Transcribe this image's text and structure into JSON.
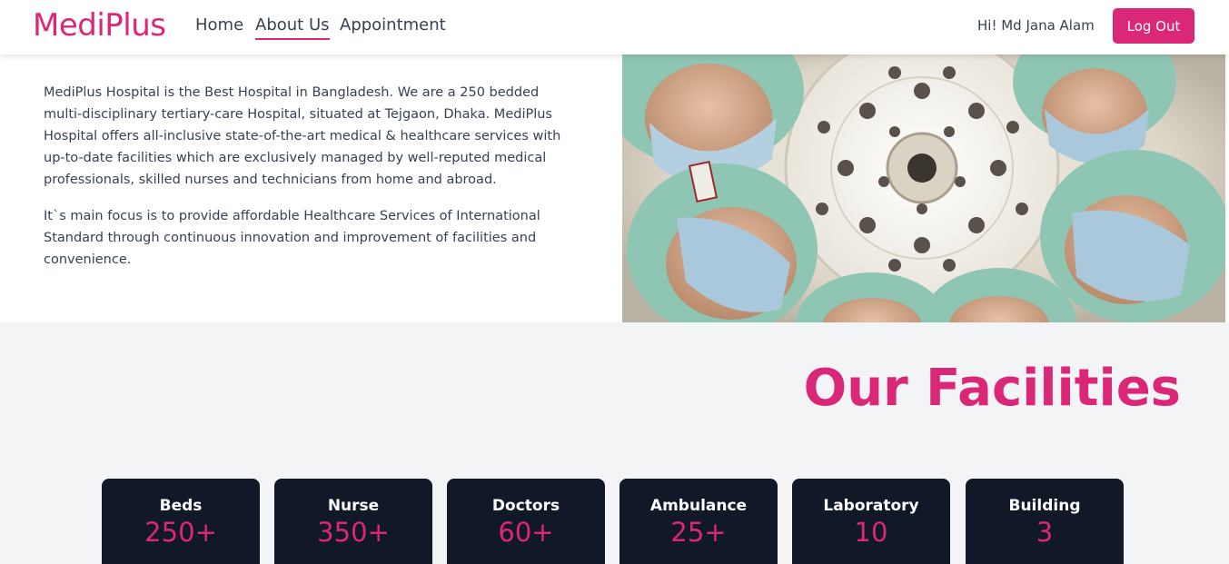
{
  "header": {
    "brand": "MediPlus",
    "nav": [
      {
        "label": "Home"
      },
      {
        "label": "About Us",
        "active": true
      },
      {
        "label": "Appointment"
      }
    ],
    "greeting": "Hi! Md Jana Alam",
    "logout_label": "Log Out"
  },
  "about": {
    "paragraph1": "MediPlus Hospital is the Best Hospital in Bangladesh. We are a 250 bedded multi-disciplinary tertiary-care Hospital, situated at Tejgaon, Dhaka. MediPlus Hospital offers all-inclusive state-of-the-art medical & healthcare services with up-to-date facilities which are exclusively managed by well-reputed medical professionals, skilled nurses and technicians from home and abroad.",
    "paragraph2": "It`s main focus is to provide affordable Healthcare Services of International Standard through continuous innovation and improvement of facilities and convenience.",
    "image_icon": "surgeons-looking-down-photo"
  },
  "facilities": {
    "title": "Our Facilities",
    "cards": [
      {
        "name": "Beds",
        "value": "250+"
      },
      {
        "name": "Nurse",
        "value": "350+"
      },
      {
        "name": "Doctors",
        "value": "60+"
      },
      {
        "name": "Ambulance",
        "value": "25+"
      },
      {
        "name": "Laboratory",
        "value": "10"
      },
      {
        "name": "Building",
        "value": "3"
      }
    ]
  },
  "colors": {
    "brand": "#db2777",
    "card_bg": "#111827",
    "section_bg": "#f3f4f6"
  }
}
